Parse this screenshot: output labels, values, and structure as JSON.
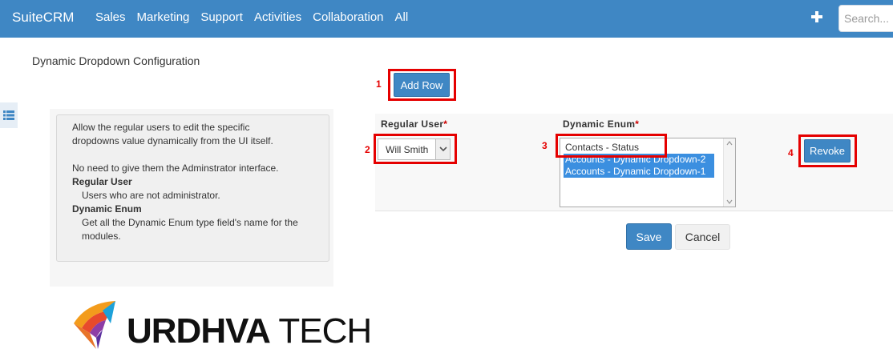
{
  "app": {
    "brand": "SuiteCRM"
  },
  "nav": {
    "items": [
      "Sales",
      "Marketing",
      "Support",
      "Activities",
      "Collaboration",
      "All"
    ]
  },
  "search": {
    "placeholder": "Search..."
  },
  "page": {
    "title": "Dynamic Dropdown Configuration"
  },
  "help": {
    "intro": "Allow the regular users to edit the specific dropdowns value dynamically from the UI itself.",
    "note": "No need to give them the Adminstrator interface.",
    "regular_user_title": "Regular User",
    "regular_user_desc": "Users who are not administrator.",
    "dynamic_enum_title": "Dynamic Enum",
    "dynamic_enum_desc": "Get all the Dynamic Enum type field's name for the modules."
  },
  "logo": {
    "text_bold": "URDHVA",
    "text_light": " TECH"
  },
  "actions": {
    "add_row": "Add Row",
    "revoke": "Revoke",
    "save": "Save",
    "cancel": "Cancel"
  },
  "table": {
    "col_user": "Regular User",
    "col_enum": "Dynamic Enum",
    "required_mark": "*",
    "selected_user": "Will Smith",
    "enum_options": [
      "Contacts - Status",
      "Accounts - Dynamic Dropdown-2",
      "Accounts - Dynamic Dropdown-1"
    ],
    "enum_selected": [
      false,
      true,
      true
    ]
  },
  "markers": [
    "1",
    "2",
    "3",
    "4"
  ],
  "colors": {
    "nav_bg": "#3f87c4",
    "primary": "#3f87c4",
    "highlight": "#e50000",
    "selection": "#3b8fe0"
  },
  "icons": {
    "plus": "plus-icon",
    "list": "list-icon",
    "dropdown": "chevron-down-icon"
  }
}
